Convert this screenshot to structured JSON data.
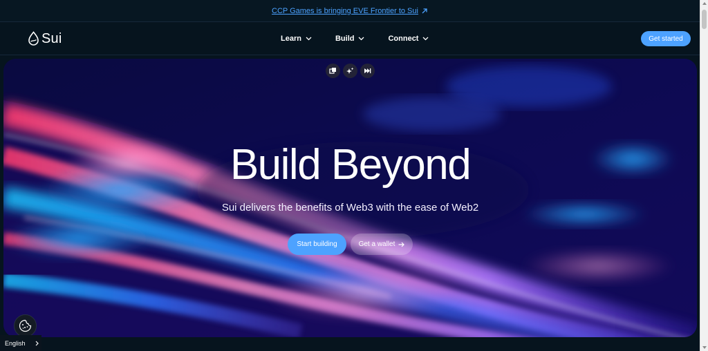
{
  "announcement": {
    "text": "CCP Games is bringing EVE Frontier to Sui",
    "icon": "arrow-up-right-icon",
    "color": "#4ca2ff"
  },
  "header": {
    "logo_text": "Sui",
    "logo_icon": "sui-drop-icon",
    "nav": [
      {
        "label": "Learn",
        "icon": "chevron-down-icon"
      },
      {
        "label": "Build",
        "icon": "chevron-down-icon"
      },
      {
        "label": "Connect",
        "icon": "chevron-down-icon"
      }
    ],
    "cta_label": "Get started",
    "accent": "#4da2ff"
  },
  "hero": {
    "controls": [
      {
        "icon": "copy-icon"
      },
      {
        "icon": "sparkle-icon"
      },
      {
        "icon": "skip-forward-icon"
      }
    ],
    "title": "Build Beyond",
    "subtitle": "Sui delivers the benefits of Web3 with the ease of Web2",
    "primary_label": "Start building",
    "secondary_label": "Get a wallet",
    "secondary_icon": "arrow-right-icon"
  },
  "footer_widgets": {
    "cookie_icon": "cookie-icon",
    "language": "English",
    "language_icon": "chevron-right-icon"
  }
}
